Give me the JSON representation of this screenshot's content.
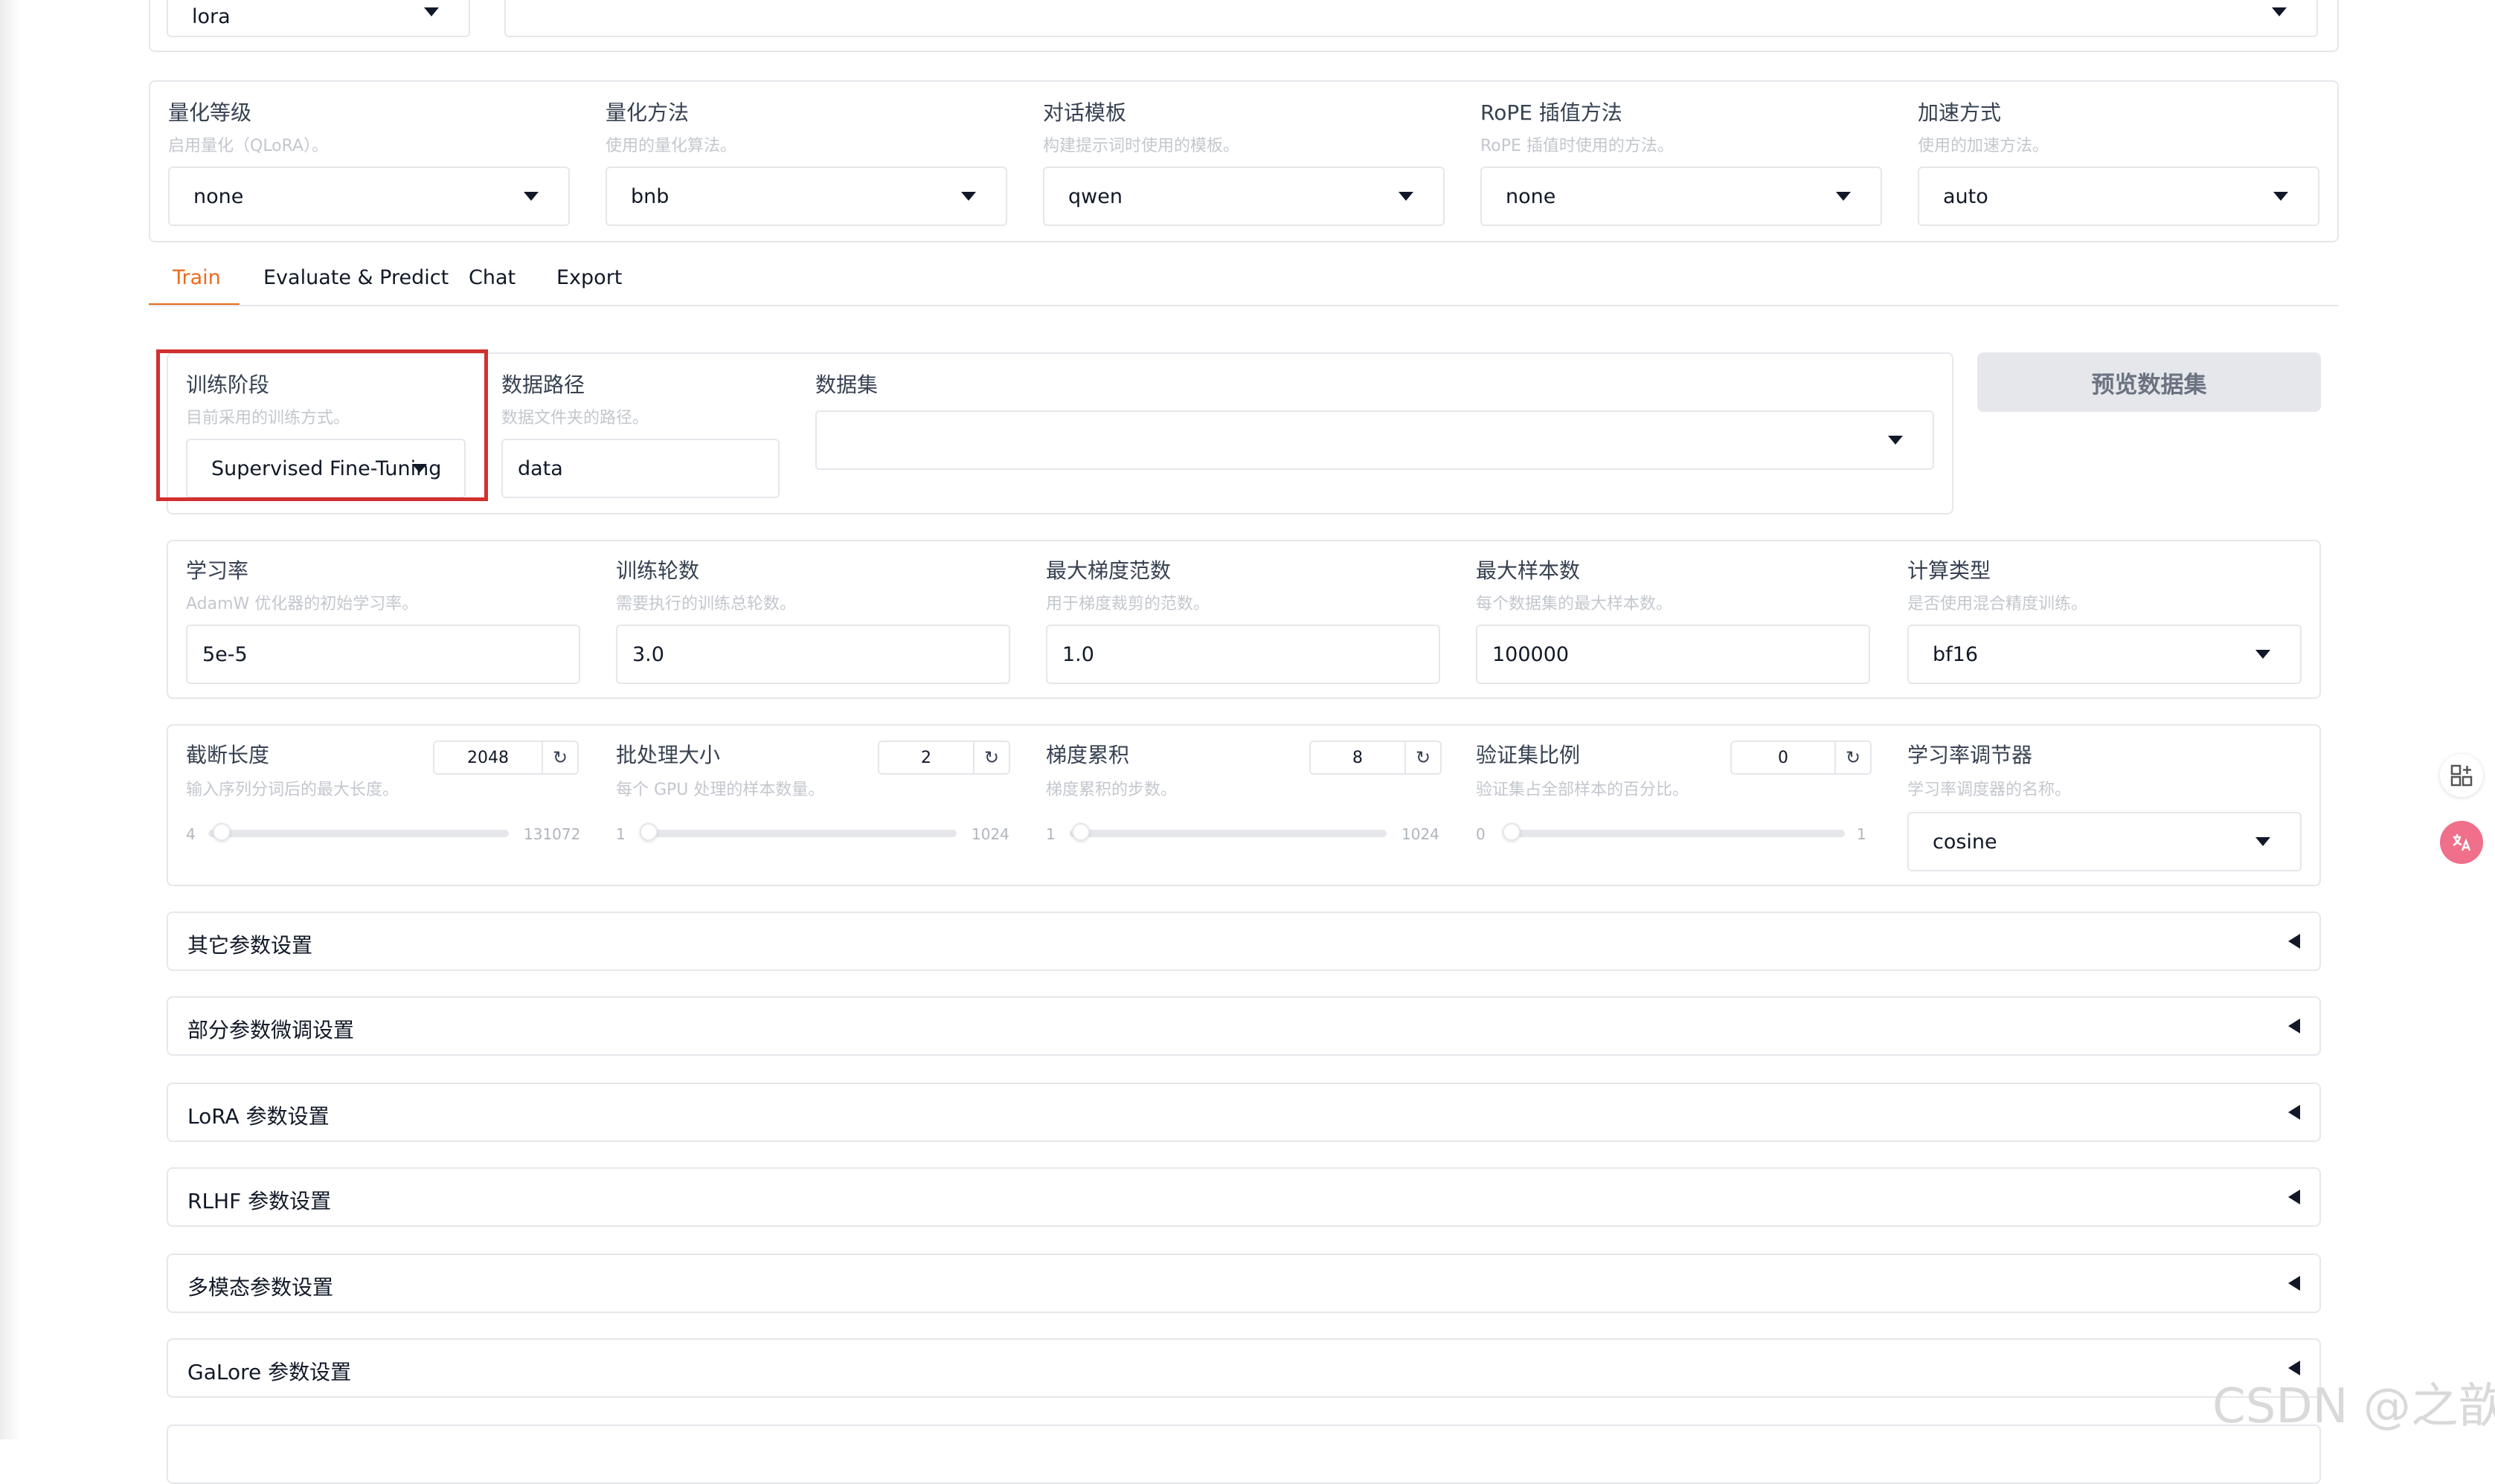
{
  "top_row": {
    "finetune_value": "lora"
  },
  "adv_config": {
    "quant_bit": {
      "label": "量化等级",
      "hint": "启用量化（QLoRA）。",
      "value": "none"
    },
    "quant_method": {
      "label": "量化方法",
      "hint": "使用的量化算法。",
      "value": "bnb"
    },
    "template": {
      "label": "对话模板",
      "hint": "构建提示词时使用的模板。",
      "value": "qwen"
    },
    "rope_scaling": {
      "label": "RoPE 插值方法",
      "hint": "RoPE 插值时使用的方法。",
      "value": "none"
    },
    "booster": {
      "label": "加速方式",
      "hint": "使用的加速方法。",
      "value": "auto"
    }
  },
  "tabs": [
    "Train",
    "Evaluate & Predict",
    "Chat",
    "Export"
  ],
  "active_tab": "Train",
  "train": {
    "stage": {
      "label": "训练阶段",
      "hint": "目前采用的训练方式。",
      "value": "Supervised Fine-Tuning"
    },
    "dataset_dir": {
      "label": "数据路径",
      "hint": "数据文件夹的路径。",
      "value": "data"
    },
    "dataset": {
      "label": "数据集",
      "value": ""
    },
    "preview_button": "预览数据集"
  },
  "hyper": {
    "learning_rate": {
      "label": "学习率",
      "hint": "AdamW 优化器的初始学习率。",
      "value": "5e-5"
    },
    "epochs": {
      "label": "训练轮数",
      "hint": "需要执行的训练总轮数。",
      "value": "3.0"
    },
    "max_grad_norm": {
      "label": "最大梯度范数",
      "hint": "用于梯度裁剪的范数。",
      "value": "1.0"
    },
    "max_samples": {
      "label": "最大样本数",
      "hint": "每个数据集的最大样本数。",
      "value": "100000"
    },
    "compute_type": {
      "label": "计算类型",
      "hint": "是否使用混合精度训练。",
      "value": "bf16"
    }
  },
  "sliders": {
    "cutoff_len": {
      "label": "截断长度",
      "hint": "输入序列分词后的最大长度。",
      "value": "2048",
      "min": "4",
      "max": "131072",
      "fraction": 0.015
    },
    "batch_size": {
      "label": "批处理大小",
      "hint": "每个 GPU 处理的样本数量。",
      "value": "2",
      "min": "1",
      "max": "1024",
      "fraction": 0.001
    },
    "grad_accum": {
      "label": "梯度累积",
      "hint": "梯度累积的步数。",
      "value": "8",
      "min": "1",
      "max": "1024",
      "fraction": 0.007
    },
    "val_size": {
      "label": "验证集比例",
      "hint": "验证集占全部样本的百分比。",
      "value": "0",
      "min": "0",
      "max": "1",
      "fraction": 0
    },
    "lr_scheduler": {
      "label": "学习率调节器",
      "hint": "学习率调度器的名称。",
      "value": "cosine"
    }
  },
  "accordions": [
    "其它参数设置",
    "部分参数微调设置",
    "LoRA 参数设置",
    "RLHF 参数设置",
    "多模态参数设置",
    "GaLore 参数设置"
  ],
  "watermark": "CSDN @之歆",
  "side_icons": [
    "apps-icon",
    "translate-icon"
  ],
  "colors": {
    "accent": "#ea6b1d",
    "highlight_box": "#d32f2f"
  }
}
